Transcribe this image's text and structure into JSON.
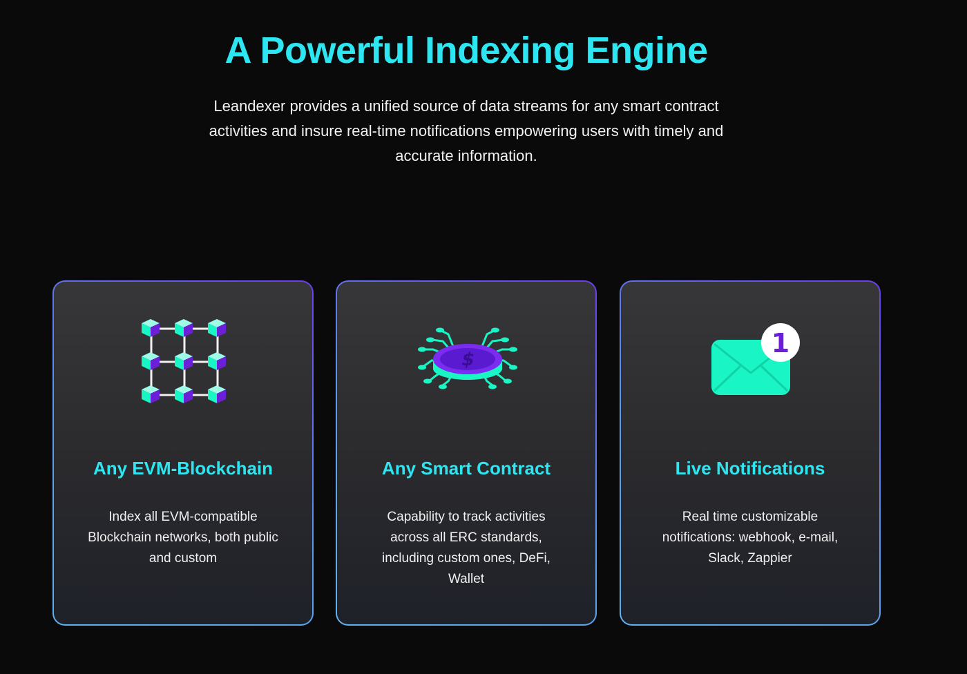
{
  "hero": {
    "title": "A Powerful Indexing Engine",
    "subtitle": "Leandexer provides a unified source of data streams for any smart contract activities and insure real-time notifications empowering users with timely and accurate information."
  },
  "features": [
    {
      "icon": "blockchain-network-icon",
      "title": "Any EVM-Blockchain",
      "description": "Index all EVM-compatible Blockchain networks, both public and custom"
    },
    {
      "icon": "smart-contract-coin-icon",
      "title": "Any Smart Contract",
      "description": "Capability to track activities across all ERC standards, including custom ones, DeFi, Wallet"
    },
    {
      "icon": "notification-envelope-icon",
      "title": "Live Notifications",
      "description": "Real time customizable notifications: webhook, e-mail, Slack, Zappier",
      "badge": "1"
    }
  ],
  "colors": {
    "background": "#0a0a0a",
    "accent_cyan": "#2ee6f2",
    "icon_teal": "#19f5c4",
    "icon_purple": "#6b1fd6",
    "border_blue": "#5fb2ef",
    "border_purple": "#6a3dea"
  }
}
